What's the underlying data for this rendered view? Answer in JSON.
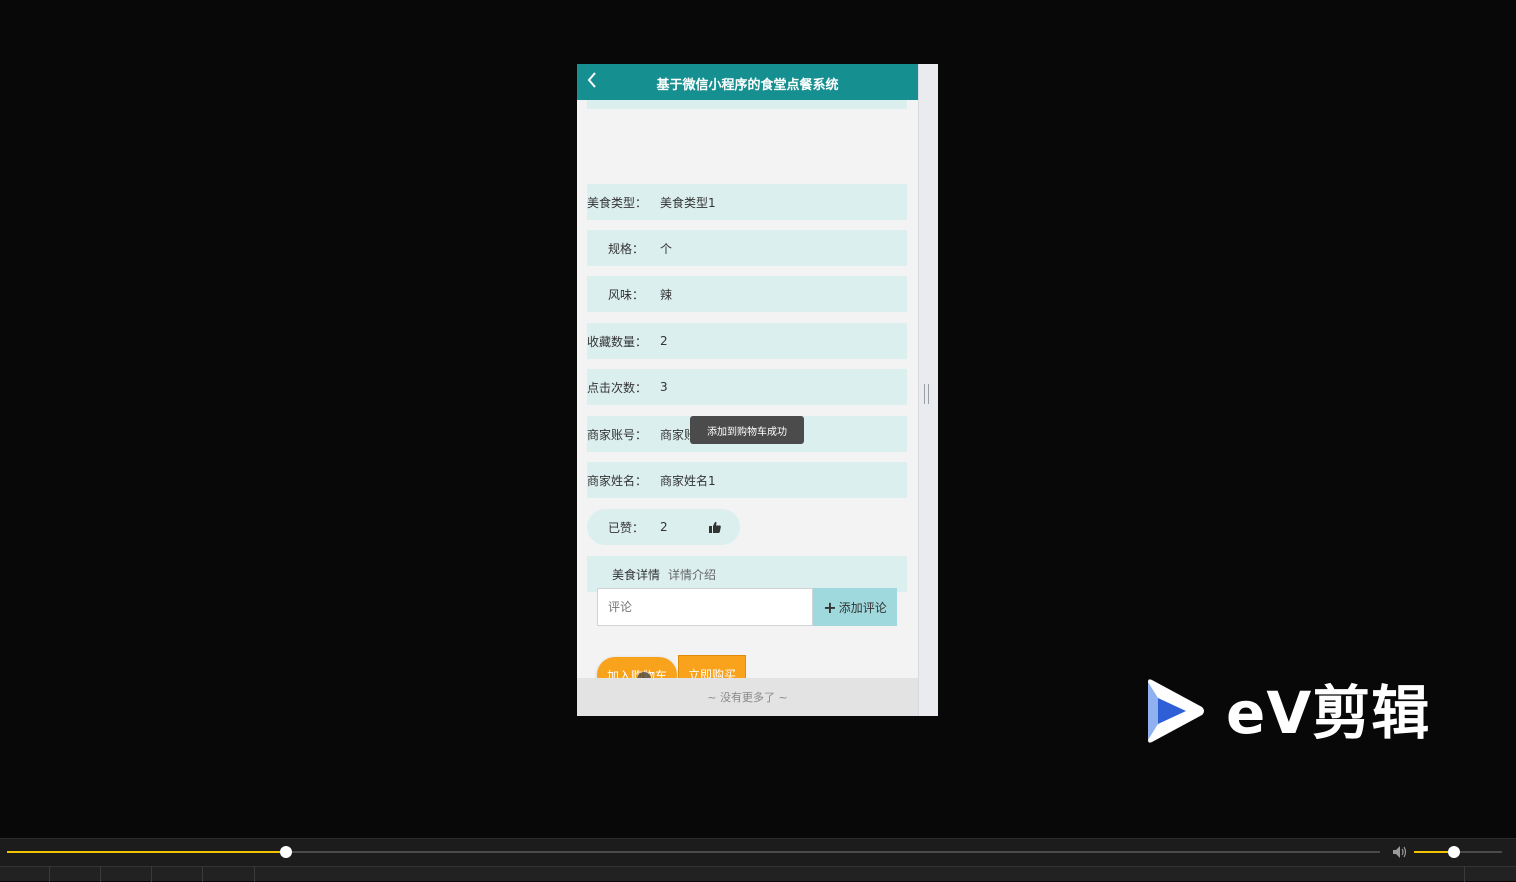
{
  "navbar": {
    "back_icon": "chevron-left-icon",
    "title": "基于微信小程序的食堂点餐系统"
  },
  "fields": [
    {
      "label": "美食类型：",
      "value": "美食类型1"
    },
    {
      "label": "规格：",
      "value": "个"
    },
    {
      "label": "风味：",
      "value": "辣"
    },
    {
      "label": "收藏数量：",
      "value": "2"
    },
    {
      "label": "点击次数：",
      "value": "3"
    },
    {
      "label": "商家账号：",
      "value": "商家账号1"
    },
    {
      "label": "商家姓名：",
      "value": "商家姓名1"
    }
  ],
  "like": {
    "label": "已赞：",
    "value": "2",
    "icon": "thumbs-up-icon"
  },
  "detail": {
    "label": "美食详情",
    "value": "详情介绍"
  },
  "comment": {
    "placeholder": "评论",
    "button_label": "添加评论"
  },
  "actions": {
    "cart_label": "加入购物车",
    "buy_label": "立即购买"
  },
  "toast": "添加到购物车成功",
  "footer": "~ 没有更多了 ~",
  "watermark": {
    "text": "eV剪辑",
    "icon": "play-logo-icon"
  },
  "player": {
    "progress": 0.203,
    "volume": 0.45
  },
  "colors": {
    "navbar": "#168f91",
    "field_bg": "#dcefef",
    "accent_orange": "#f9a21b",
    "progress": "#f2c200"
  }
}
